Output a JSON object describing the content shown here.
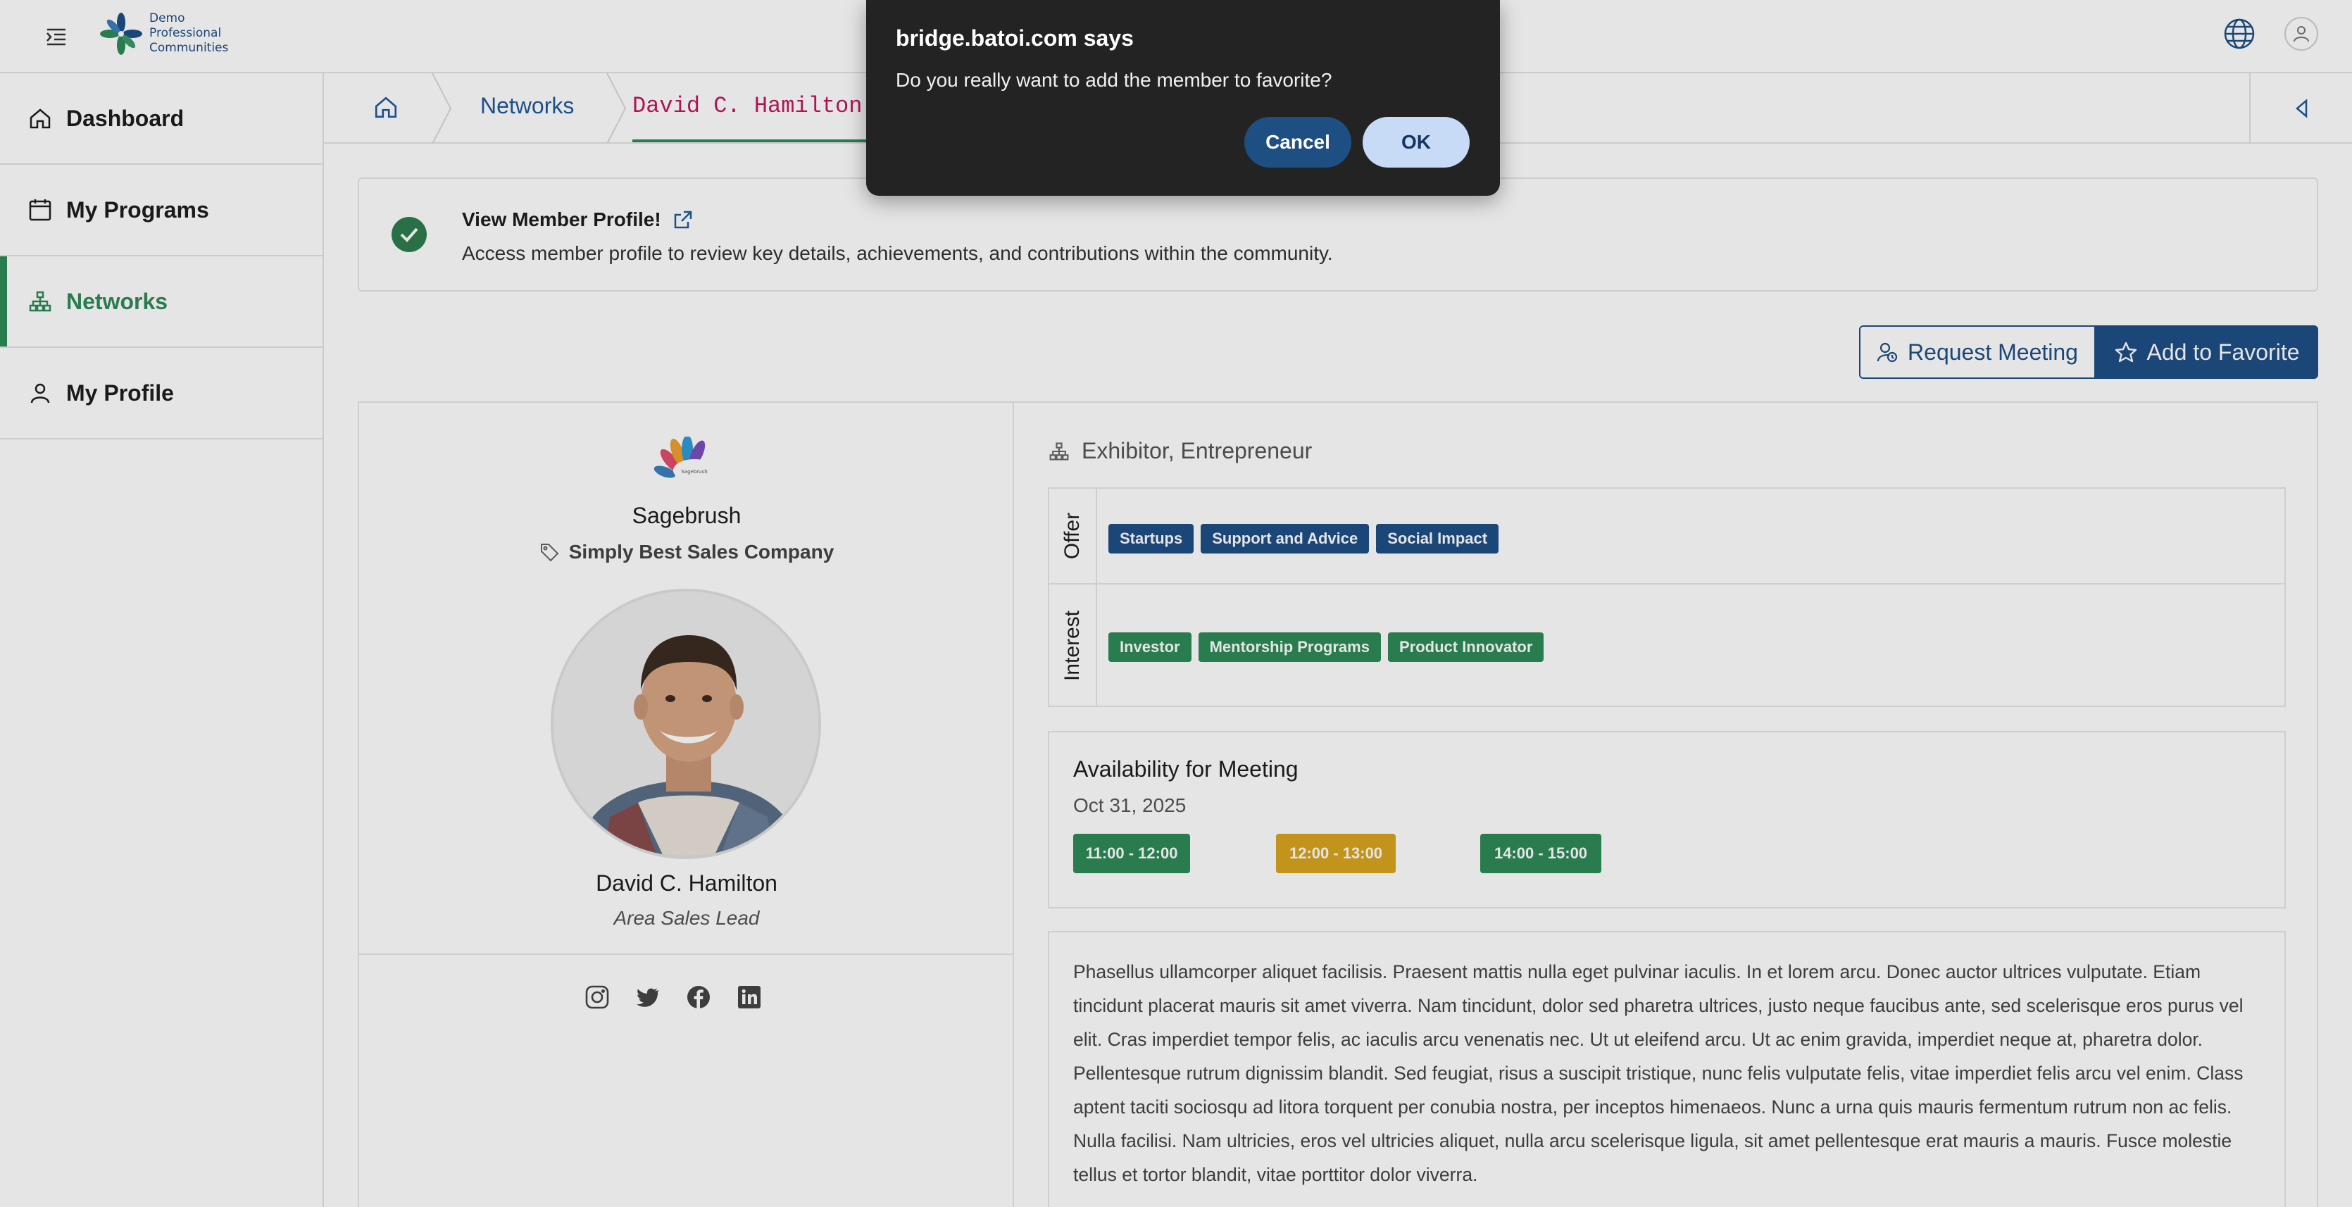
{
  "app": {
    "logo_lines": [
      "Demo",
      "Professional",
      "Communities"
    ]
  },
  "sidebar": {
    "items": [
      {
        "label": "Dashboard",
        "icon": "home-icon"
      },
      {
        "label": "My Programs",
        "icon": "calendar-icon"
      },
      {
        "label": "Networks",
        "icon": "network-icon",
        "active": true
      },
      {
        "label": "My Profile",
        "icon": "user-icon"
      }
    ]
  },
  "breadcrumb": {
    "items": [
      "Networks",
      "David C. Hamilton"
    ]
  },
  "banner": {
    "title": "View Member Profile!",
    "description": "Access member profile to review key details, achievements, and contributions within the community."
  },
  "actions": {
    "request_meeting": "Request Meeting",
    "add_favorite": "Add to Favorite"
  },
  "profile": {
    "organization": "Sagebrush",
    "company": "Simply Best Sales Company",
    "name": "David C. Hamilton",
    "title": "Area Sales Lead",
    "socials": [
      "instagram-icon",
      "twitter-icon",
      "facebook-icon",
      "linkedin-icon"
    ],
    "roles": "Exhibitor, Entrepreneur",
    "offer_label": "Offer",
    "offer": [
      "Startups",
      "Support and Advice",
      "Social Impact"
    ],
    "interest_label": "Interest",
    "interest": [
      "Investor",
      "Mentorship Programs",
      "Product Innovator"
    ],
    "availability": {
      "title": "Availability for Meeting",
      "date": "Oct 31, 2025",
      "slots": [
        {
          "label": "11:00 - 12:00",
          "status": "available"
        },
        {
          "label": "12:00 - 13:00",
          "status": "pending"
        },
        {
          "label": "14:00 - 15:00",
          "status": "available"
        }
      ]
    },
    "bio": "Phasellus ullamcorper aliquet facilisis. Praesent mattis nulla eget pulvinar iaculis. In et lorem arcu. Donec auctor ultrices vulputate. Etiam tincidunt placerat mauris sit amet viverra. Nam tincidunt, dolor sed pharetra ultrices, justo neque faucibus ante, sed scelerisque eros purus vel elit. Cras imperdiet tempor felis, ac iaculis arcu venenatis nec. Ut ut eleifend arcu. Ut ac enim gravida, imperdiet neque at, pharetra dolor. Pellentesque rutrum dignissim blandit. Sed feugiat, risus a suscipit tristique, nunc felis vulputate felis, vitae imperdiet felis arcu vel enim. Class aptent taciti sociosqu ad litora torquent per conubia nostra, per inceptos himenaeos. Nunc a urna quis mauris fermentum rutrum non ac felis. Nulla facilisi. Nam ultricies, eros vel ultricies aliquet, nulla arcu scelerisque ligula, sit amet pellentesque erat mauris a mauris. Fusce molestie tellus et tortor blandit, vitae porttitor dolor viverra."
  },
  "dialog": {
    "title": "bridge.batoi.com says",
    "message": "Do you really want to add the member to favorite?",
    "cancel": "Cancel",
    "ok": "OK"
  },
  "colors": {
    "primary": "#1f4e86",
    "accent_green": "#2e8b57",
    "slot_pending": "#d9a520",
    "dialog_bg": "#232323"
  }
}
